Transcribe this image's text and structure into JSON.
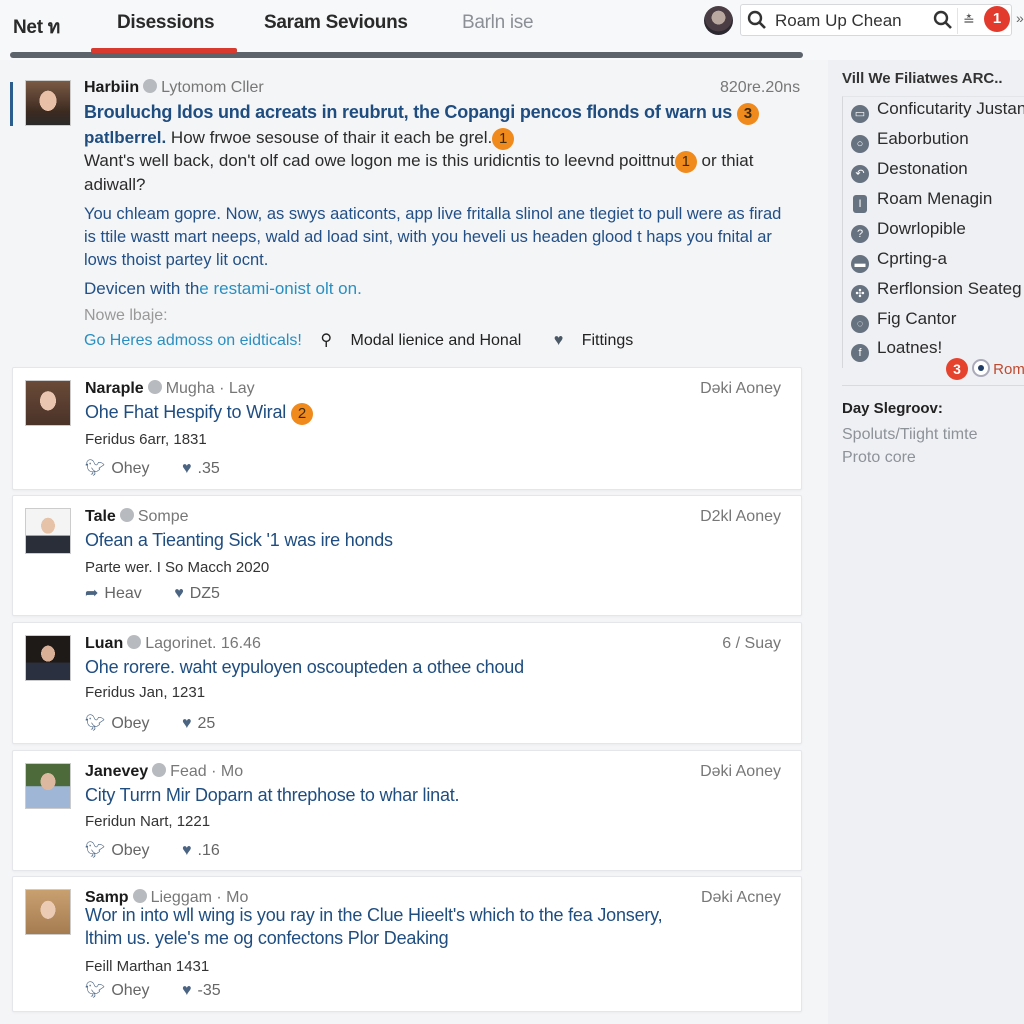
{
  "header": {
    "tabs": [
      {
        "label": "Net ท",
        "state": "normal"
      },
      {
        "label": "Disessions",
        "state": "active"
      },
      {
        "label": "Saram Seviouns",
        "state": "normal"
      },
      {
        "label": "Barln ise",
        "state": "dim"
      }
    ],
    "search": {
      "value": "Roam Up Chean",
      "placeholder": "Search"
    },
    "notification_count": "1",
    "accent_color": "#d83a30"
  },
  "featured": {
    "author": "Harbiin",
    "handle": "Lytomom Cller",
    "time": "820re.20ns",
    "title_bold": "Brouluchg ldos  und acreats in reubrut, the Copangi pencos flonds of warn us",
    "title_badge": "3",
    "line2_bold": "patlberrel.",
    "line2_rest": " How frwoe sesouse of thair it each be grel.",
    "line2_badge": "1",
    "line3": "Want's well back, don't olf cad owe logon me is this uridicntis to leevnd poittnut",
    "line3_badge": "1",
    "line3_end": " or thiat adiwall?",
    "paragraph": "You chleam gopre. Now, as swys aaticonts, app live fritalla slinol ane tlegiet to pull were as firad is ttile wastt mart neeps, wald ad load sint, with you heveli us headen glood t haps you fnital ar lows thoist partey lit ocnt.",
    "device_prefix": "Devicen with th",
    "device_link": "e restami-onist olt on.",
    "note_label": "Nowe lbaje:",
    "actions": {
      "link": "Go Heres admoss on eidticals!",
      "search_action": "Modal lienice and Honal",
      "like_action": "Fittings"
    }
  },
  "posts": [
    {
      "author": "Naraple",
      "handle": "Mugha · Lay",
      "right": "Dǝki Aoney",
      "title": "Ohe Fhat Hespify to Wiral",
      "badge": "2",
      "date": "Feridus 6arr, 1831",
      "share": "Ohey",
      "likes": ".35"
    },
    {
      "author": "Tale",
      "handle": "Sompe",
      "right": "D2kl Aoney",
      "title": "Ofean a Tieanting Sick '1 was ire honds",
      "badge": "",
      "date": "Parte wer. I So Macch  2020",
      "share": "Heav",
      "likes": "DZ5"
    },
    {
      "author": "Luan",
      "handle": "Lagorinet. 16.46",
      "right": "6 / Suay",
      "title": "Ohe rorere. waht eypuloyen oscoupteden a othee choud",
      "badge": "",
      "date": "Feridus Jan, 1231",
      "share": "Obey",
      "likes": "25"
    },
    {
      "author": "Janevey",
      "handle": "Fead · Mo",
      "right": "Dǝki Aoney",
      "title": "City Turrn Mir Doparn at threphose to whar linat.",
      "badge": "",
      "date": "Feridun Nart, 1221",
      "share": "Obey",
      "likes": ".16"
    },
    {
      "author": "Samp",
      "handle": "Lieggam · Mo",
      "right": "Dǝki Acney",
      "title": "Wor in into wll wing is you ray in the Clue Hieelt's which to the fea Jonsery,",
      "title2": "lthim us. yele's me og confectons Plor Deaking",
      "badge": "",
      "date": "Feill Marthan 1431",
      "share": "Ohey",
      "likes": "-35"
    }
  ],
  "sidebar": {
    "heading": "Vill We Filiatwes ARC..",
    "items": [
      {
        "label": "Conficutarity Justan",
        "icon": "chat-icon"
      },
      {
        "label": "Eaborbution",
        "icon": "circle-icon"
      },
      {
        "label": "Destonation",
        "icon": "undo-icon"
      },
      {
        "label": "Roam Menagin",
        "icon": "bookmark-icon"
      },
      {
        "label": "Dowrlopible",
        "icon": "question-icon"
      },
      {
        "label": "Cprting-a",
        "icon": "minus-icon"
      },
      {
        "label": "Rerflonsion Seateg",
        "icon": "globe-icon"
      },
      {
        "label": "Fig Cantor",
        "icon": "message-icon"
      },
      {
        "label": "Loatnes!",
        "icon": "facebook-icon"
      }
    ],
    "footer_badge": "3",
    "footer_label": "Rom",
    "sub_heading": "Day Slegroov:",
    "sub_lines": [
      "Spoluts/Tiight timte",
      "Proto core"
    ]
  }
}
